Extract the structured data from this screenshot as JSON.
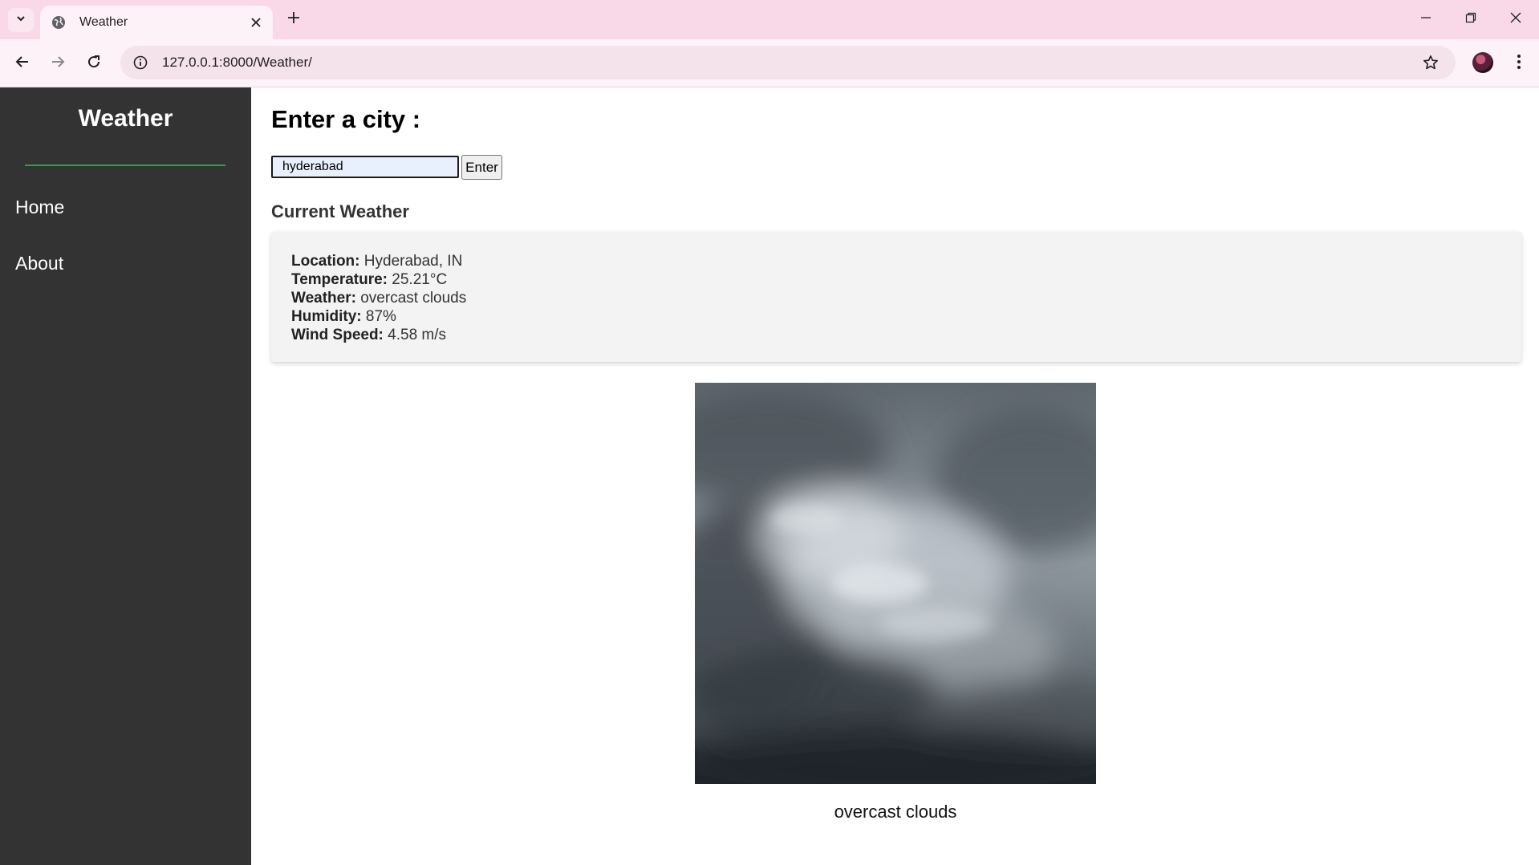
{
  "browser": {
    "tab_title": "Weather",
    "url": "127.0.0.1:8000/Weather/"
  },
  "sidebar": {
    "brand": "Weather",
    "items": [
      {
        "label": "Home"
      },
      {
        "label": "About"
      }
    ]
  },
  "main": {
    "heading": "Enter a city :",
    "city_input_value": "hyderabad",
    "enter_button": "Enter",
    "current_weather_heading": "Current Weather",
    "weather": {
      "location_label": "Location:",
      "location_value": "Hyderabad, IN",
      "temperature_label": "Temperature:",
      "temperature_value": "25.21°C",
      "weather_label": "Weather:",
      "weather_value": "overcast clouds",
      "humidity_label": "Humidity:",
      "humidity_value": "87%",
      "wind_label": "Wind Speed:",
      "wind_value": "4.58 m/s"
    },
    "image_caption": "overcast clouds"
  },
  "colors": {
    "sidebar_bg": "#333333",
    "brand_underline": "#2ea043",
    "card_bg": "#f3f3f3",
    "tabbar_bg": "#f9d9e8"
  }
}
